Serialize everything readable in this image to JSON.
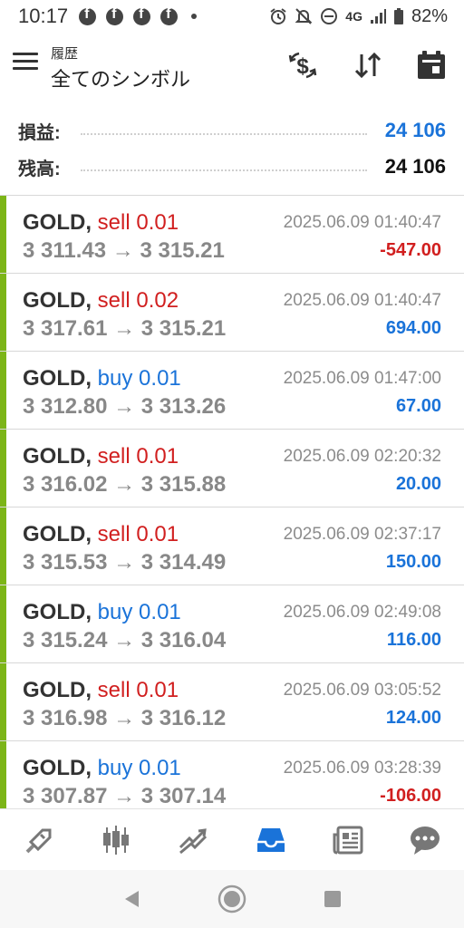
{
  "status_bar": {
    "time": "10:17",
    "network": "4G",
    "battery": "82%"
  },
  "header": {
    "subtitle": "履歴",
    "title": "全てのシンボル"
  },
  "summary": {
    "profit_label": "損益:",
    "profit_value": "24 106",
    "balance_label": "残高:",
    "balance_value": "24 106"
  },
  "colors": {
    "accent_green": "#7cb518",
    "sell_red": "#d11f1f",
    "buy_blue": "#1a73d9",
    "active_nav": "#1a73d9"
  },
  "trades": [
    {
      "symbol": "GOLD,",
      "side": "sell",
      "volume": "0.01",
      "open": "3 311.43",
      "arrow": "→",
      "close": "3 315.21",
      "datetime": "2025.06.09 01:40:47",
      "profit": "-547.00"
    },
    {
      "symbol": "GOLD,",
      "side": "sell",
      "volume": "0.02",
      "open": "3 317.61",
      "arrow": "→",
      "close": "3 315.21",
      "datetime": "2025.06.09 01:40:47",
      "profit": "694.00"
    },
    {
      "symbol": "GOLD,",
      "side": "buy",
      "volume": "0.01",
      "open": "3 312.80",
      "arrow": "→",
      "close": "3 313.26",
      "datetime": "2025.06.09 01:47:00",
      "profit": "67.00"
    },
    {
      "symbol": "GOLD,",
      "side": "sell",
      "volume": "0.01",
      "open": "3 316.02",
      "arrow": "→",
      "close": "3 315.88",
      "datetime": "2025.06.09 02:20:32",
      "profit": "20.00"
    },
    {
      "symbol": "GOLD,",
      "side": "sell",
      "volume": "0.01",
      "open": "3 315.53",
      "arrow": "→",
      "close": "3 314.49",
      "datetime": "2025.06.09 02:37:17",
      "profit": "150.00"
    },
    {
      "symbol": "GOLD,",
      "side": "buy",
      "volume": "0.01",
      "open": "3 315.24",
      "arrow": "→",
      "close": "3 316.04",
      "datetime": "2025.06.09 02:49:08",
      "profit": "116.00"
    },
    {
      "symbol": "GOLD,",
      "side": "sell",
      "volume": "0.01",
      "open": "3 316.98",
      "arrow": "→",
      "close": "3 316.12",
      "datetime": "2025.06.09 03:05:52",
      "profit": "124.00"
    },
    {
      "symbol": "GOLD,",
      "side": "buy",
      "volume": "0.01",
      "open": "3 307.87",
      "arrow": "→",
      "close": "3 307.14",
      "datetime": "2025.06.09 03:28:39",
      "profit": "-106.00"
    }
  ],
  "bottom_nav": {
    "items": [
      "quotes-icon",
      "chart-icon",
      "trade-icon",
      "history-icon",
      "news-icon",
      "chat-icon"
    ],
    "active": "history-icon"
  }
}
